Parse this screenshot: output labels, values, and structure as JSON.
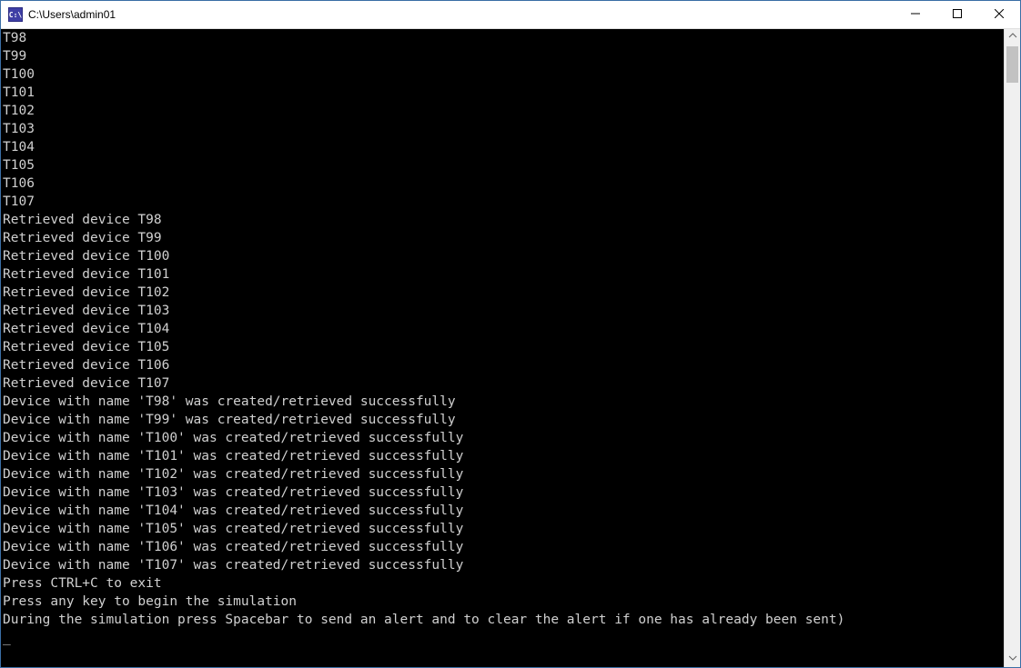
{
  "window": {
    "title": "C:\\Users\\admin01",
    "icon_label": "C:\\"
  },
  "console": {
    "lines": [
      "T98",
      "T99",
      "T100",
      "T101",
      "T102",
      "T103",
      "T104",
      "T105",
      "T106",
      "T107",
      "Retrieved device T98",
      "Retrieved device T99",
      "Retrieved device T100",
      "Retrieved device T101",
      "Retrieved device T102",
      "Retrieved device T103",
      "Retrieved device T104",
      "Retrieved device T105",
      "Retrieved device T106",
      "Retrieved device T107",
      "Device with name 'T98' was created/retrieved successfully",
      "Device with name 'T99' was created/retrieved successfully",
      "Device with name 'T100' was created/retrieved successfully",
      "Device with name 'T101' was created/retrieved successfully",
      "Device with name 'T102' was created/retrieved successfully",
      "Device with name 'T103' was created/retrieved successfully",
      "Device with name 'T104' was created/retrieved successfully",
      "Device with name 'T105' was created/retrieved successfully",
      "Device with name 'T106' was created/retrieved successfully",
      "Device with name 'T107' was created/retrieved successfully",
      "Press CTRL+C to exit",
      "Press any key to begin the simulation",
      "During the simulation press Spacebar to send an alert and to clear the alert if one has already been sent)",
      "_"
    ]
  }
}
